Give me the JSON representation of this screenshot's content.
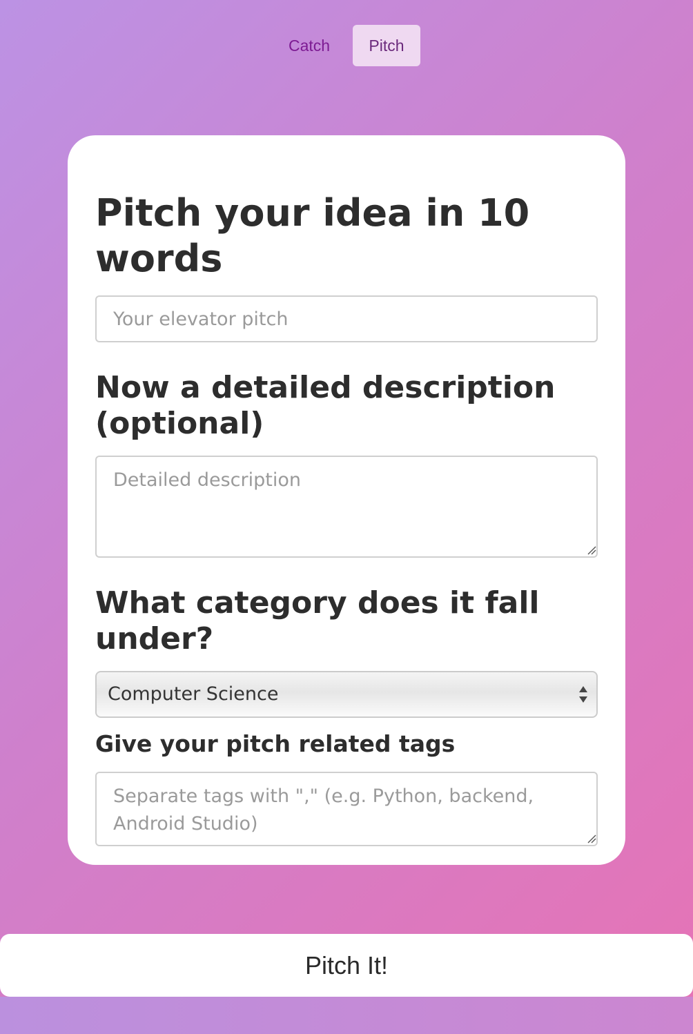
{
  "nav": {
    "tabs": [
      {
        "label": "Catch",
        "active": false
      },
      {
        "label": "Pitch",
        "active": true
      }
    ]
  },
  "form": {
    "pitch_heading": "Pitch your idea in 10 words",
    "pitch_placeholder": "Your elevator pitch",
    "description_heading": "Now a detailed description (optional)",
    "description_placeholder": "Detailed description",
    "category_heading": "What category does it fall under?",
    "category_selected": "Computer Science",
    "tags_heading": "Give your pitch related tags",
    "tags_placeholder": "Separate tags with \",\" (e.g. Python, backend, Android Studio)"
  },
  "submit": {
    "label": "Pitch It!"
  },
  "icons": {
    "select_arrows": "up-down-arrows-icon",
    "resize_grip": "resize-grip-icon"
  },
  "colors": {
    "active_tab_bg": "#efd9f1",
    "catch_tab_text": "#7d1b93",
    "gradient_start": "#bc92e4",
    "gradient_end": "#e673b5"
  }
}
